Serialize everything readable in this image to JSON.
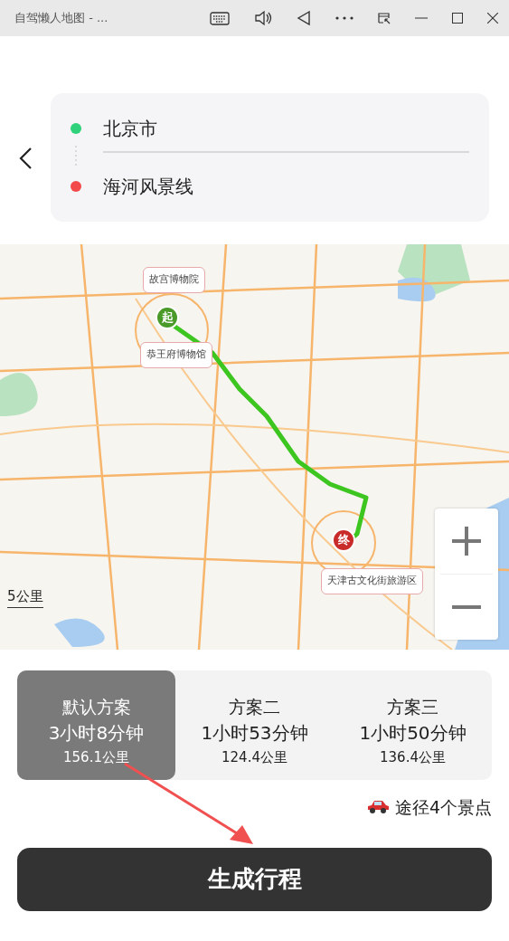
{
  "window": {
    "title": "自驾懒人地图 - ..."
  },
  "route": {
    "start": "北京市",
    "end": "海河风景线"
  },
  "map": {
    "start_marker": "起",
    "end_marker": "终",
    "scale": "5公里",
    "pois": [
      {
        "label": "故宫博物院"
      },
      {
        "label": "恭王府博物馆"
      },
      {
        "label": "天津古文化街旅游区"
      }
    ]
  },
  "plans": [
    {
      "name": "默认方案",
      "duration": "3小时8分钟",
      "distance": "156.1公里",
      "selected": true
    },
    {
      "name": "方案二",
      "duration": "1小时53分钟",
      "distance": "124.4公里",
      "selected": false
    },
    {
      "name": "方案三",
      "duration": "1小时50分钟",
      "distance": "136.4公里",
      "selected": false
    }
  ],
  "summary": "途径4个景点",
  "generate_button": "生成行程"
}
